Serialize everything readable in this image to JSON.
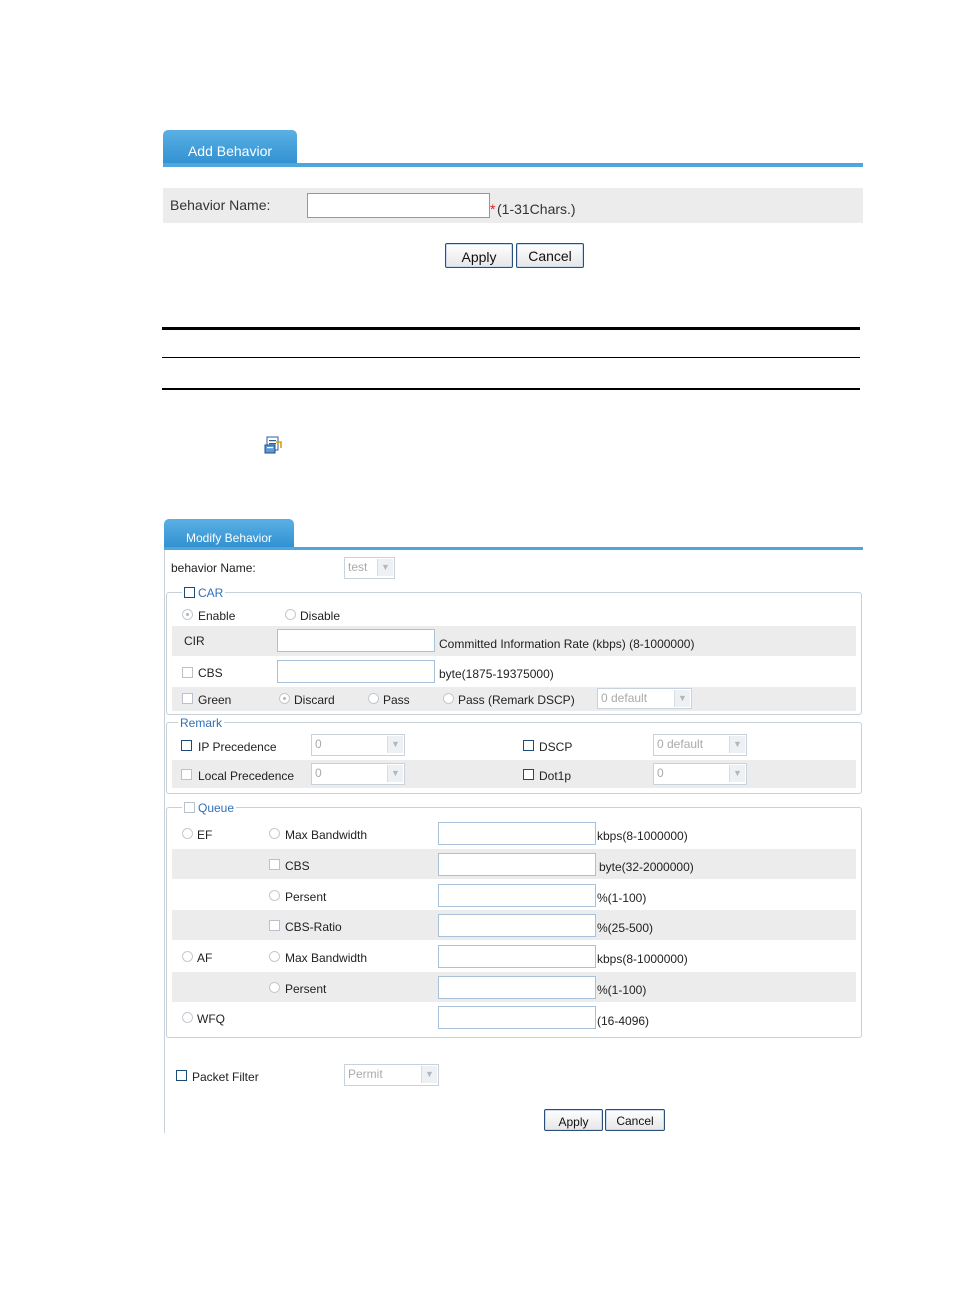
{
  "add_behavior": {
    "tab": "Add Behavior",
    "name_label": "Behavior Name:",
    "name_value": "",
    "required_mark": "*",
    "hint": "(1-31Chars.)",
    "apply": "Apply",
    "cancel": "Cancel"
  },
  "modify_behavior": {
    "tab": "Modify Behavior",
    "name_label": "behavior Name:",
    "name_select": "test",
    "car": {
      "legend": "CAR",
      "enable": "Enable",
      "disable": "Disable",
      "cir_label": "CIR",
      "cir_hint": "Committed Information Rate (kbps) (8-1000000)",
      "cbs_label": "CBS",
      "cbs_hint": "byte(1875-19375000)",
      "green_label": "Green",
      "discard": "Discard",
      "pass": "Pass",
      "pass_remark": "Pass (Remark DSCP)",
      "dscp_select": "0 default"
    },
    "remark": {
      "legend": "Remark",
      "ip_precedence": "IP Precedence",
      "ip_precedence_value": "0",
      "dscp": "DSCP",
      "dscp_value": "0 default",
      "local_precedence": "Local Precedence",
      "local_precedence_value": "0",
      "dot1p": "Dot1p",
      "dot1p_value": "0"
    },
    "queue": {
      "legend": "Queue",
      "ef": "EF",
      "af": "AF",
      "wfq": "WFQ",
      "max_bandwidth": "Max Bandwidth",
      "cbs": "CBS",
      "persent": "Persent",
      "cbs_ratio": "CBS-Ratio",
      "ef_maxbw_hint": "kbps(8-1000000)",
      "ef_cbs_hint": "byte(32-2000000)",
      "ef_persent_hint": "%(1-100)",
      "ef_cbsratio_hint": "%(25-500)",
      "af_maxbw_hint": "kbps(8-1000000)",
      "af_persent_hint": "%(1-100)",
      "wfq_hint": "(16-4096)"
    },
    "packet_filter": {
      "label": "Packet Filter",
      "select": "Permit"
    },
    "apply": "Apply",
    "cancel": "Cancel"
  }
}
